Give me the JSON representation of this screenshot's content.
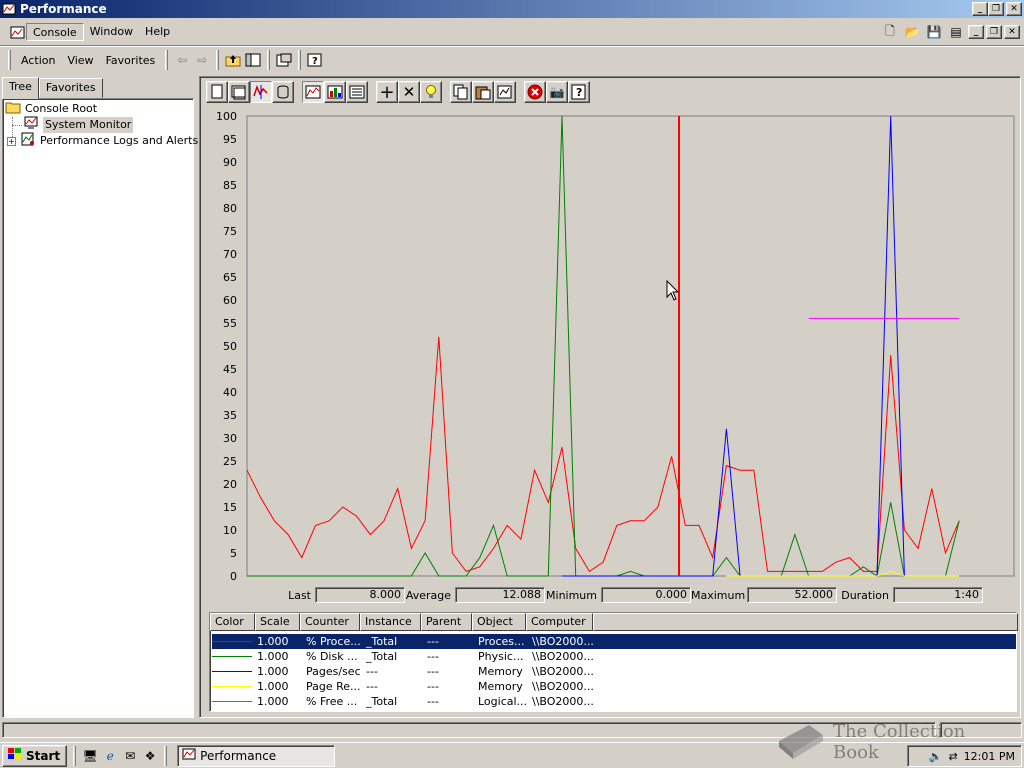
{
  "window": {
    "title": "Performance"
  },
  "menubar": {
    "items": [
      "Console",
      "Window",
      "Help"
    ]
  },
  "toolbar": {
    "items": [
      "Action",
      "View",
      "Favorites"
    ]
  },
  "tree": {
    "tabs": [
      "Tree",
      "Favorites"
    ],
    "nodes": [
      "Console Root",
      "System Monitor",
      "Performance Logs and Alerts"
    ]
  },
  "chart_data": {
    "type": "line",
    "ylim": [
      0,
      100
    ],
    "yticks": [
      "100",
      "95",
      "90",
      "85",
      "80",
      "75",
      "70",
      "65",
      "60",
      "55",
      "50",
      "45",
      "40",
      "35",
      "30",
      "25",
      "20",
      "15",
      "10",
      "5",
      "0"
    ],
    "x": [
      0,
      1,
      2,
      3,
      4,
      5,
      6,
      7,
      8,
      9,
      10,
      11,
      12,
      13,
      14,
      15,
      16,
      17,
      18,
      19,
      20,
      21,
      22,
      23,
      24,
      25,
      26,
      27,
      28,
      29,
      30,
      31,
      32,
      33,
      34,
      35,
      36,
      37,
      38,
      39,
      40,
      41,
      42,
      43,
      44,
      45,
      46,
      47,
      48,
      49,
      50,
      51,
      52,
      53,
      54,
      55,
      56
    ],
    "series": [
      {
        "color": "#ff0000",
        "values": [
          23,
          17,
          12,
          9,
          4,
          11,
          12,
          15,
          13,
          9,
          12,
          19,
          6,
          12,
          52,
          5,
          1,
          2,
          6,
          11,
          8,
          23,
          16,
          28,
          6,
          1,
          3,
          11,
          12,
          12,
          15,
          26,
          11,
          11,
          4,
          24,
          23,
          23,
          1,
          1,
          1,
          1,
          1,
          3,
          4,
          1,
          1,
          48,
          10,
          6,
          19,
          5,
          12,
          null,
          null,
          null,
          null
        ]
      },
      {
        "color": "#008000",
        "values": [
          0,
          0,
          0,
          0,
          0,
          0,
          0,
          0,
          0,
          0,
          0,
          0,
          0,
          5,
          0,
          0,
          0,
          4,
          11,
          0,
          0,
          0,
          0,
          100,
          0,
          0,
          0,
          0,
          1,
          0,
          0,
          0,
          0,
          0,
          0,
          4,
          0,
          0,
          0,
          0,
          9,
          0,
          0,
          0,
          0,
          2,
          0,
          16,
          0,
          0,
          0,
          0,
          12,
          null,
          null,
          null,
          null
        ]
      },
      {
        "color": "#0000ff",
        "values": [
          null,
          null,
          null,
          null,
          null,
          null,
          null,
          null,
          null,
          null,
          null,
          null,
          null,
          null,
          null,
          null,
          null,
          null,
          null,
          null,
          null,
          null,
          null,
          0,
          0,
          0,
          0,
          0,
          0,
          0,
          0,
          0,
          0,
          0,
          0,
          32,
          0,
          0,
          0,
          0,
          0,
          0,
          0,
          0,
          0,
          0,
          0,
          100,
          0,
          0,
          0,
          0,
          0,
          null,
          null,
          null,
          null
        ]
      },
      {
        "color": "#ffff00",
        "values": [
          null,
          null,
          null,
          null,
          null,
          null,
          null,
          null,
          null,
          null,
          null,
          null,
          null,
          null,
          null,
          null,
          null,
          null,
          null,
          null,
          null,
          null,
          null,
          null,
          null,
          null,
          null,
          null,
          null,
          null,
          null,
          null,
          null,
          null,
          null,
          0,
          0,
          0,
          0,
          0,
          0,
          0,
          0,
          0,
          0,
          0,
          0,
          1,
          0,
          0,
          0,
          0,
          0,
          null,
          null,
          null,
          null
        ]
      },
      {
        "color": "#ff00ff",
        "values": [
          null,
          null,
          null,
          null,
          null,
          null,
          null,
          null,
          null,
          null,
          null,
          null,
          null,
          null,
          null,
          null,
          null,
          null,
          null,
          null,
          null,
          null,
          null,
          null,
          null,
          null,
          null,
          null,
          null,
          null,
          null,
          null,
          null,
          null,
          null,
          null,
          null,
          null,
          null,
          null,
          null,
          56,
          56,
          56,
          56,
          56,
          56,
          56,
          56,
          56,
          56,
          56,
          56,
          null,
          null,
          null,
          null
        ]
      }
    ]
  },
  "stats": {
    "last_label": "Last",
    "last": "8.000",
    "avg_label": "Average",
    "avg": "12.088",
    "min_label": "Minimum",
    "min": "0.000",
    "max_label": "Maximum",
    "max": "52.000",
    "dur_label": "Duration",
    "dur": "1:40"
  },
  "legend": {
    "headers": [
      "Color",
      "Scale",
      "Counter",
      "Instance",
      "Parent",
      "Object",
      "Computer"
    ],
    "rows": [
      {
        "color": "#ff0000",
        "scale": "1.000",
        "counter": "% Proce...",
        "instance": "_Total",
        "parent": "---",
        "object": "Proces...",
        "computer": "\\\\BO2000..."
      },
      {
        "color": "#008000",
        "scale": "1.000",
        "counter": "% Disk ...",
        "instance": "_Total",
        "parent": "---",
        "object": "Physic...",
        "computer": "\\\\BO2000..."
      },
      {
        "color": "#0000ff",
        "scale": "1.000",
        "counter": "Pages/sec",
        "instance": "---",
        "parent": "---",
        "object": "Memory",
        "computer": "\\\\BO2000..."
      },
      {
        "color": "#ffff00",
        "scale": "1.000",
        "counter": "Page Re...",
        "instance": "---",
        "parent": "---",
        "object": "Memory",
        "computer": "\\\\BO2000..."
      },
      {
        "color": "#ff00ff",
        "scale": "1.000",
        "counter": "% Free ...",
        "instance": "_Total",
        "parent": "---",
        "object": "Logical...",
        "computer": "\\\\BO2000..."
      }
    ]
  },
  "taskbar": {
    "start": "Start",
    "task": "Performance",
    "clock": "12:01 PM"
  },
  "watermark": "The Collection Book"
}
